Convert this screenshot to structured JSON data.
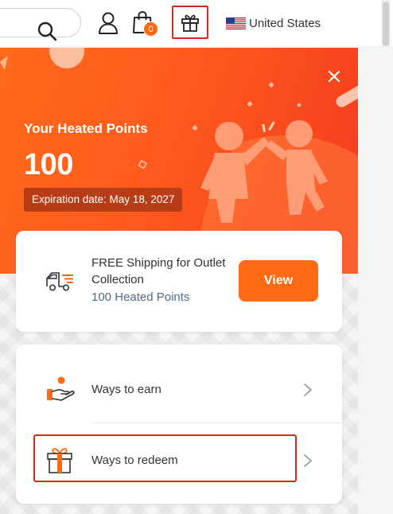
{
  "header": {
    "search_icon": "search-icon",
    "account_icon": "user-icon",
    "bag_count": "0",
    "gift_icon": "gift-icon",
    "country": "United States"
  },
  "rewards_panel": {
    "title": "Your Heated Points",
    "points": "100",
    "expiration": "Expiration date: May 18, 2027",
    "close_icon": "close-icon"
  },
  "reward_card": {
    "title": "FREE Shipping for Outlet Collection",
    "points_required": "100 Heated Points",
    "view_label": "View",
    "icon": "delivery-truck-icon"
  },
  "menu": {
    "items": [
      {
        "label": "Ways to earn",
        "icon": "hand-coin-icon"
      },
      {
        "label": "Ways to redeem",
        "icon": "gift-icon"
      }
    ]
  },
  "colors": {
    "accent": "#ff6a13",
    "badge": "#b83d17",
    "highlight": "#d8281b",
    "link_text": "#4f6b86"
  }
}
